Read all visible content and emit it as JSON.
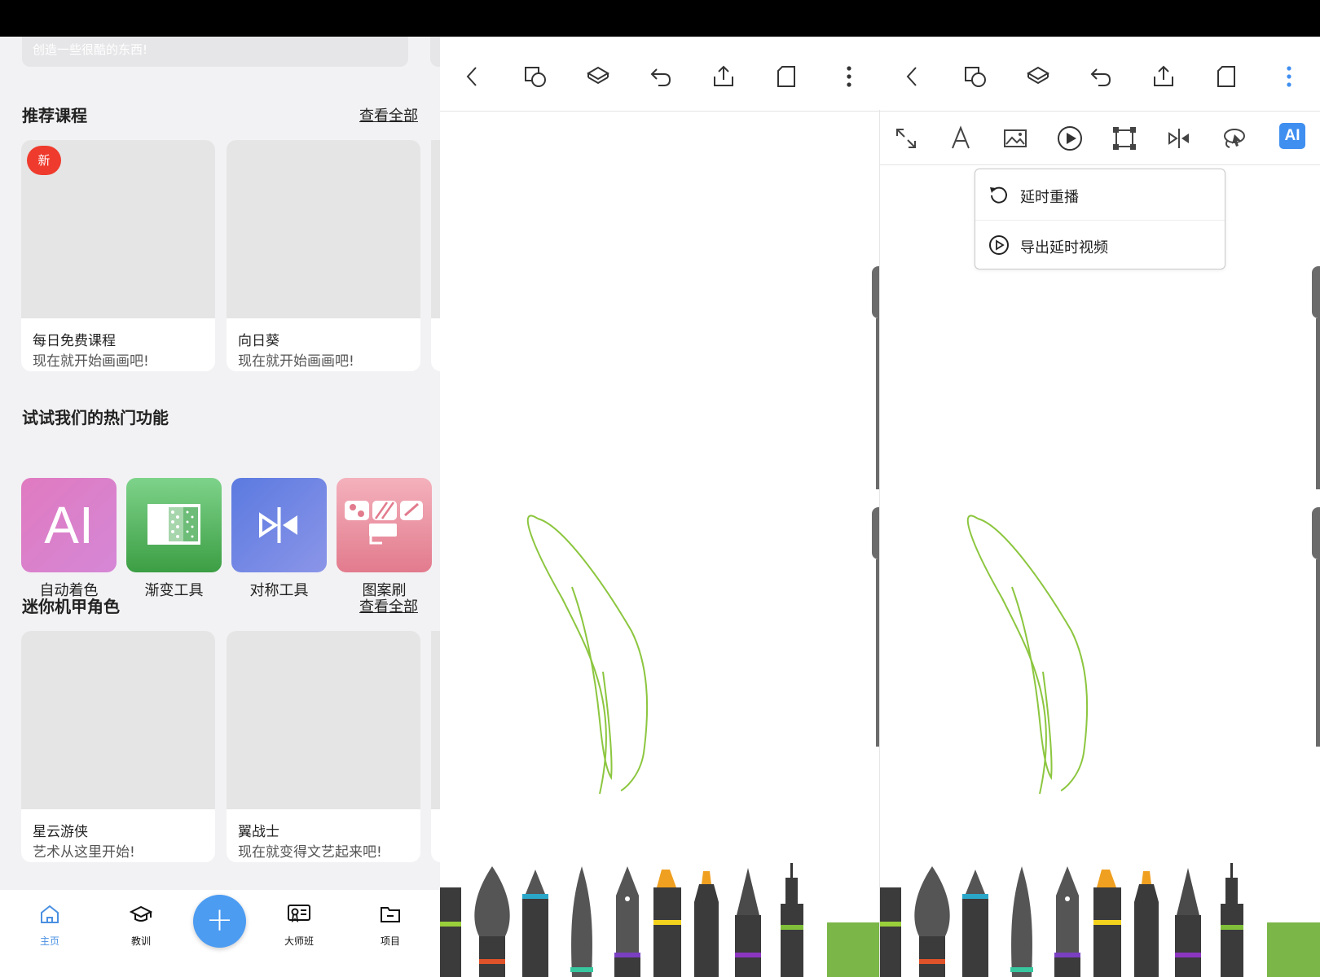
{
  "home": {
    "banner_text": "创造一些很酷的东西!",
    "recommended": {
      "title": "推荐课程",
      "see_all": "查看全部",
      "badge": "新",
      "cards": [
        {
          "title": "每日免费课程",
          "subtitle": "现在就开始画画吧!"
        },
        {
          "title": "向日葵",
          "subtitle": "现在就开始画画吧!"
        }
      ]
    },
    "features": {
      "title": "试试我们的热门功能",
      "items": [
        {
          "label": "自动着色",
          "icon": "ai-icon",
          "icon_text": "AI"
        },
        {
          "label": "渐变工具",
          "icon": "gradient-icon"
        },
        {
          "label": "对称工具",
          "icon": "symmetry-icon"
        },
        {
          "label": "图案刷",
          "icon": "pattern-brush-icon"
        }
      ]
    },
    "mecha": {
      "title": "迷你机甲角色",
      "see_all": "查看全部",
      "cards": [
        {
          "title": "星云游侠",
          "subtitle": "艺术从这里开始!"
        },
        {
          "title": "翼战士",
          "subtitle": "现在就变得文艺起来吧!"
        }
      ]
    },
    "nav": {
      "items": [
        {
          "label": "主页",
          "icon": "home-icon",
          "active": true
        },
        {
          "label": "教训",
          "icon": "graduation-cap-icon",
          "active": false
        },
        {
          "label": "大师班",
          "icon": "masterclass-icon",
          "active": false
        },
        {
          "label": "项目",
          "icon": "folder-icon",
          "active": false
        }
      ],
      "fab_label": "+"
    }
  },
  "canvas": {
    "toolbar_icons": [
      "back-icon",
      "shapes-icon",
      "layers-icon",
      "undo-icon",
      "share-icon",
      "page-icon",
      "more-icon"
    ],
    "secondary_toolbar_icons": [
      "expand-icon",
      "text-icon",
      "image-icon",
      "play-icon",
      "transform-icon",
      "symmetry-icon",
      "lasso-icon",
      "ai-icon"
    ],
    "ai_label": "AI",
    "menu": {
      "items": [
        {
          "label": "延时重播",
          "icon": "replay-icon"
        },
        {
          "label": "导出延时视频",
          "icon": "play-circle-icon"
        }
      ]
    },
    "stroke_color": "#8cc63f",
    "accent_color": "#3f8ff0",
    "swatch_color": "#7ab648"
  }
}
